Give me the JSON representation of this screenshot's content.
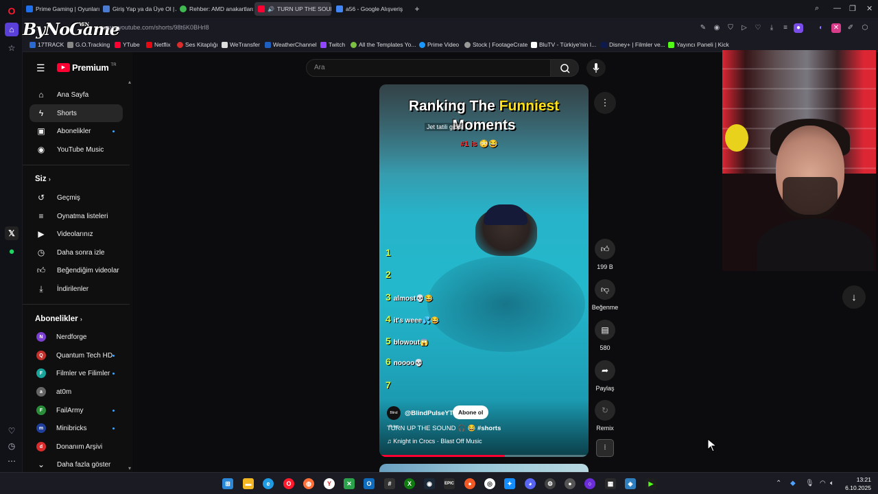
{
  "browser": {
    "tabs": [
      {
        "label": "Prime Gaming | Oyunları İ...",
        "color": "#1f6feb"
      },
      {
        "label": "Giriş Yap ya da Üye Ol | Al...",
        "color": "#4a7bd0"
      },
      {
        "label": "Rehber: AMD anakartlarda...",
        "color": "#3fb950"
      },
      {
        "label": "TURN UP THE SOUND",
        "color": "#ff0033",
        "active": true
      },
      {
        "label": "a56 - Google Alışveriş",
        "color": "#4285f4"
      }
    ],
    "new_tab": "+",
    "brand": "ByNoGame",
    "brand_small": "VEN",
    "url": "www.youtube.com/shorts/98t6K0BHrl8",
    "bookmarks": [
      "17TRACK",
      "G.O.Tracking",
      "YTube",
      "Netflix",
      "Ses Kitaplığı",
      "WeTransfer",
      "WeatherChannel",
      "Twitch",
      "All the Templates Yo...",
      "Prime Video",
      "Stock | FootageCrate",
      "BluTV - Türkiye'nin I...",
      "Disney+ | Filmler ve...",
      "Yayıncı Paneli | Kick"
    ]
  },
  "youtube": {
    "logo": "Premium",
    "logo_badge": "TR",
    "search_placeholder": "Ara",
    "nav": [
      {
        "label": "Ana Sayfa",
        "icon": "home-icon"
      },
      {
        "label": "Shorts",
        "icon": "shorts-icon",
        "active": true
      },
      {
        "label": "Abonelikler",
        "icon": "subscriptions-icon",
        "dot": true
      },
      {
        "label": "YouTube Music",
        "icon": "music-icon"
      }
    ],
    "you_title": "Siz",
    "you_items": [
      "Geçmiş",
      "Oynatma listeleri",
      "Videolarınız",
      "Daha sonra izle",
      "Beğendiğim videolar",
      "İndirilenler"
    ],
    "subs_title": "Abonelikler",
    "subs": [
      {
        "name": "Nerdforge",
        "color": "#7a3ed0",
        "dot": false
      },
      {
        "name": "Quantum Tech HD",
        "color": "#c4302b",
        "dot": true
      },
      {
        "name": "Filmler ve Filimler",
        "color": "#1aa39a",
        "dot": true
      },
      {
        "name": "at0m",
        "color": "#666666",
        "dot": false
      },
      {
        "name": "FailArmy",
        "color": "#2a8d3a",
        "dot": true
      },
      {
        "name": "Minibricks",
        "color": "#1f3f9a",
        "dot": true
      },
      {
        "name": "Donanım Arşivi",
        "color": "#d92c2c",
        "dot": false
      }
    ],
    "show_more": "Daha fazla göster"
  },
  "short": {
    "overlay_title_a": "Ranking The ",
    "overlay_title_highlight": "Funniest",
    "overlay_title_b": "Moments",
    "caption": "Jet tatili gibisi",
    "hint": "#1 is 😳😂",
    "ranks": [
      {
        "n": "1",
        "t": ""
      },
      {
        "n": "2",
        "t": ""
      },
      {
        "n": "3",
        "t": "almost💀😂"
      },
      {
        "n": "4",
        "t": "it's weee💦😂"
      },
      {
        "n": "5",
        "t": "blowout😱"
      },
      {
        "n": "6",
        "t": "noooo💀"
      },
      {
        "n": "7",
        "t": ""
      }
    ],
    "channel_avatar_text": "Blind Pulse",
    "channel": "@BlindPulseYT",
    "subscribe": "Abone ol",
    "title": "TURN UP THE SOUND 🎧 😂 ",
    "title_tag": "#shorts",
    "music": "♫ Knight in Crocs · Blast Off Music",
    "progress": 0.6,
    "likes": "199 B",
    "dislike": "Beğenme",
    "comments": "580",
    "share": "Paylaş",
    "remix": "Remix"
  },
  "taskbar": {
    "time": "13:21",
    "date": "6.10.2025"
  }
}
